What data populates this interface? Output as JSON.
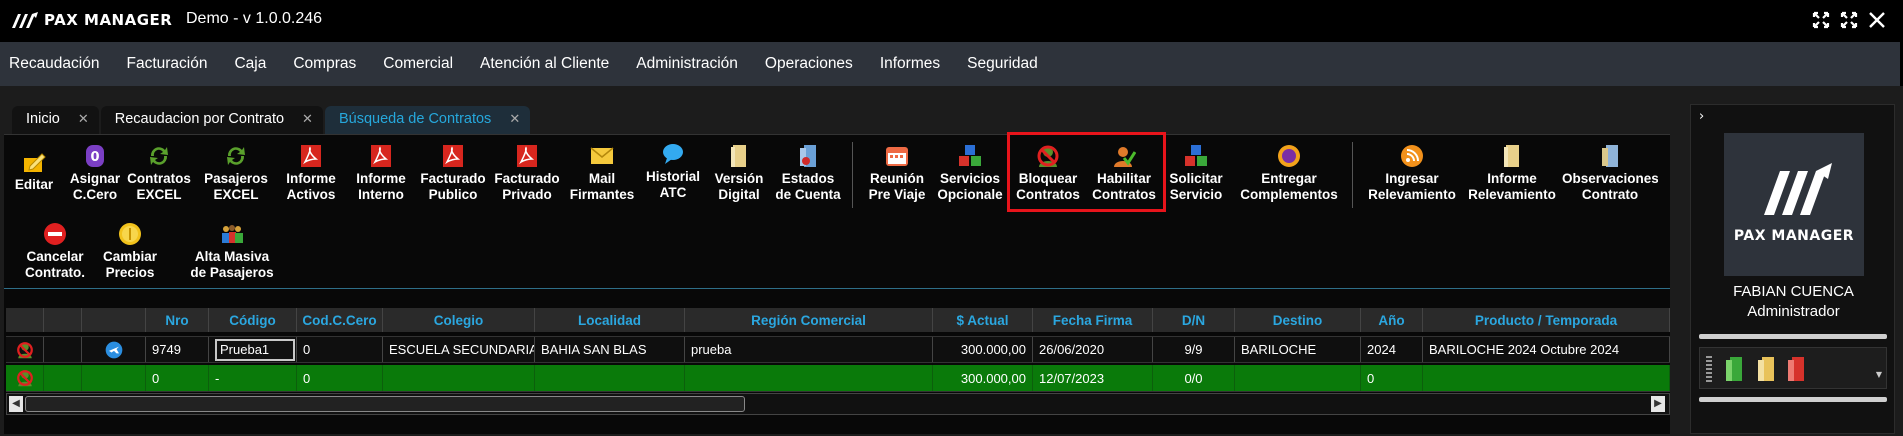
{
  "app": {
    "logo_text": "PAX MANAGER",
    "title": "Demo - v 1.0.0.246"
  },
  "menu": [
    "Recaudación",
    "Facturación",
    "Caja",
    "Compras",
    "Comercial",
    "Atención al Cliente",
    "Administración",
    "Operaciones",
    "Informes",
    "Seguridad"
  ],
  "tabs": [
    {
      "label": "Inicio",
      "close": "✕"
    },
    {
      "label": "Recaudacion por Contrato",
      "close": "✕"
    },
    {
      "label": "Búsqueda de Contratos",
      "close": "✕"
    }
  ],
  "toolbar": {
    "editar": [
      "Editar"
    ],
    "asignar": [
      "Asignar",
      "C.Cero"
    ],
    "contratos_excel": [
      "Contratos",
      "EXCEL"
    ],
    "pasajeros_excel": [
      "Pasajeros",
      "EXCEL"
    ],
    "informe_activos": [
      "Informe",
      "Activos"
    ],
    "informe_interno": [
      "Informe",
      "Interno"
    ],
    "facturado_publico": [
      "Facturado",
      "Publico"
    ],
    "facturado_privado": [
      "Facturado",
      "Privado"
    ],
    "mail_firmantes": [
      "Mail",
      "Firmantes"
    ],
    "historial_atc": [
      "Historial",
      "ATC"
    ],
    "version_digital": [
      "Versión",
      "Digital"
    ],
    "estados_cuenta": [
      "Estados",
      "de Cuenta"
    ],
    "reunion": [
      "Reunión",
      "Pre Viaje"
    ],
    "servicios": [
      "Servicios",
      "Opcionale"
    ],
    "bloquear": [
      "Bloquear",
      "Contratos"
    ],
    "habilitar": [
      "Habilitar",
      "Contratos"
    ],
    "solicitar": [
      "Solicitar",
      "Servicio"
    ],
    "entregar": [
      "Entregar",
      "Complementos"
    ],
    "ingresar": [
      "Ingresar",
      "Relevamiento"
    ],
    "informe_relev": [
      "Informe",
      "Relevamiento"
    ],
    "observaciones": [
      "Observaciones",
      "Contrato"
    ],
    "cancelar": [
      "Cancelar",
      "Contrato."
    ],
    "cambiar": [
      "Cambiar",
      "Precios"
    ],
    "alta_masiva": [
      "Alta Masiva",
      "de Pasajeros"
    ]
  },
  "grid": {
    "headers": [
      "Nro",
      "Código",
      "Cod.C.Cero",
      "Colegio",
      "Localidad",
      "Región Comercial",
      "$ Actual",
      "Fecha Firma",
      "D/N",
      "Destino",
      "Año",
      "Producto / Temporada"
    ],
    "rows": [
      {
        "nro": "9749",
        "codigo": "Prueba1",
        "cod_cero": "0",
        "colegio": "ESCUELA SECUNDARIA I",
        "localidad": "BAHIA SAN BLAS",
        "region": "prueba",
        "actual": "300.000,00",
        "fecha": "26/06/2020",
        "dn": "9/9",
        "destino": "BARILOCHE",
        "anio": "2024",
        "producto": "BARILOCHE 2024 Octubre 2024"
      },
      {
        "nro": "0",
        "codigo": "-",
        "cod_cero": "0",
        "colegio": "",
        "localidad": "",
        "region": "",
        "actual": "300.000,00",
        "fecha": "12/07/2023",
        "dn": "0/0",
        "destino": "",
        "anio": "0",
        "producto": ""
      }
    ]
  },
  "user": {
    "avatar_text": "PAX MANAGER",
    "name": "FABIAN CUENCA",
    "role": "Administrador"
  },
  "colors": {
    "accent": "#26a8dc",
    "menu_bg": "#2e333b",
    "green_row": "#0a7a0a",
    "highlight": "#e8141b"
  }
}
